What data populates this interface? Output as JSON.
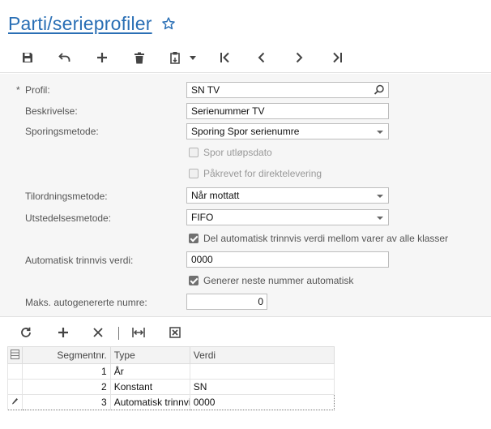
{
  "page": {
    "title": "Parti/serieprofiler"
  },
  "toolbar": {
    "icons": [
      "save-icon",
      "undo-icon",
      "add-icon",
      "delete-icon",
      "paste-icon",
      "dropdown-arrow-icon",
      "first-record-icon",
      "previous-record-icon",
      "next-record-icon",
      "last-record-icon"
    ]
  },
  "form": {
    "required_marker": "*",
    "profil_label": "Profil:",
    "profil_value": "SN TV",
    "beskrivelse_label": "Beskrivelse:",
    "beskrivelse_value": "Serienummer TV",
    "sporingsmetode_label": "Sporingsmetode:",
    "sporingsmetode_value": "Sporing Spor serienumre",
    "spor_utlopsdato_label": "Spor utløpsdato",
    "spor_utlopsdato_checked": false,
    "pakrevet_label": "Påkrevet for direktelevering",
    "pakrevet_checked": false,
    "tilordningsmetode_label": "Tilordningsmetode:",
    "tilordningsmetode_value": "Når mottatt",
    "utstedelsesmetode_label": "Utstedelsesmetode:",
    "utstedelsesmetode_value": "FIFO",
    "del_auto_label": "Del automatisk trinnvis verdi mellom varer av alle klasser",
    "del_auto_checked": true,
    "auto_trinnvis_label": "Automatisk trinnvis verdi:",
    "auto_trinnvis_value": "0000",
    "generer_label": "Generer neste nummer automatisk",
    "generer_checked": true,
    "maks_label": "Maks. autogenererte numre:",
    "maks_value": "0"
  },
  "grid": {
    "toolbar_icons": [
      "refresh-icon",
      "add-row-icon",
      "delete-row-icon",
      "fit-columns-icon",
      "export-excel-icon"
    ],
    "columns": [
      "Segmentnr.",
      "Type",
      "Verdi"
    ],
    "rows": [
      {
        "segment": "1",
        "type": "År",
        "verdi": ""
      },
      {
        "segment": "2",
        "type": "Konstant",
        "verdi": "SN"
      },
      {
        "segment": "3",
        "type": "Automatisk trinnvis",
        "verdi": "0000"
      }
    ]
  },
  "colors": {
    "accent": "#2a6fb5",
    "form_background": "#f6f6f6",
    "toolbar_icon": "#444444"
  }
}
